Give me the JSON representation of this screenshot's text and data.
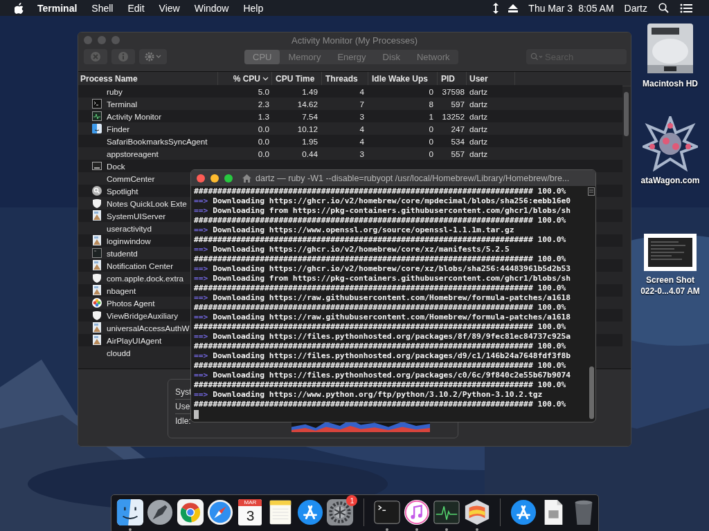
{
  "menu_bar": {
    "app": "Terminal",
    "menus": [
      "Shell",
      "Edit",
      "View",
      "Window",
      "Help"
    ],
    "clock_day": "Thu Mar 3",
    "clock_time": "8:05 AM",
    "user": "Dartz"
  },
  "activity_monitor": {
    "title": "Activity Monitor (My Processes)",
    "tabs": [
      {
        "label": "CPU",
        "selected": true
      },
      {
        "label": "Memory",
        "selected": false
      },
      {
        "label": "Energy",
        "selected": false
      },
      {
        "label": "Disk",
        "selected": false
      },
      {
        "label": "Network",
        "selected": false
      }
    ],
    "search": {
      "placeholder": "Search"
    },
    "columns": [
      {
        "label": "Process Name",
        "sorted": false
      },
      {
        "label": "% CPU",
        "sorted": true
      },
      {
        "label": "CPU Time",
        "sorted": false
      },
      {
        "label": "Threads",
        "sorted": false
      },
      {
        "label": "Idle Wake Ups",
        "sorted": false
      },
      {
        "label": "PID",
        "sorted": false
      },
      {
        "label": "User",
        "sorted": false
      }
    ],
    "processes": [
      {
        "name": "ruby",
        "kind": "plain",
        "values": [
          "5.0",
          "1.49",
          "4",
          "0",
          "37598",
          "dartz"
        ]
      },
      {
        "name": "Terminal",
        "kind": "terminal",
        "values": [
          "2.3",
          "14.62",
          "7",
          "8",
          "597",
          "dartz"
        ]
      },
      {
        "name": "Activity Monitor",
        "kind": "monitor",
        "values": [
          "1.3",
          "7.54",
          "3",
          "1",
          "13252",
          "dartz"
        ]
      },
      {
        "name": "Finder",
        "kind": "finder",
        "values": [
          "0.0",
          "10.12",
          "4",
          "0",
          "247",
          "dartz"
        ]
      },
      {
        "name": "SafariBookmarksSyncAgent",
        "kind": "plain",
        "values": [
          "0.0",
          "1.95",
          "4",
          "0",
          "534",
          "dartz"
        ]
      },
      {
        "name": "appstoreagent",
        "kind": "plain",
        "values": [
          "0.0",
          "0.44",
          "3",
          "0",
          "557",
          "dartz"
        ]
      },
      {
        "name": "Dock",
        "kind": "dock"
      },
      {
        "name": "CommCenter",
        "kind": "plain"
      },
      {
        "name": "Spotlight",
        "kind": "spotlight"
      },
      {
        "name": "Notes QuickLook Exte",
        "kind": "shield"
      },
      {
        "name": "SystemUIServer",
        "kind": "app"
      },
      {
        "name": "useractivityd",
        "kind": "plain"
      },
      {
        "name": "loginwindow",
        "kind": "app"
      },
      {
        "name": "studentd",
        "kind": "console"
      },
      {
        "name": "Notification Center",
        "kind": "app"
      },
      {
        "name": "com.apple.dock.extra",
        "kind": "shield"
      },
      {
        "name": "nbagent",
        "kind": "app"
      },
      {
        "name": "Photos Agent",
        "kind": "photos"
      },
      {
        "name": "ViewBridgeAuxiliary",
        "kind": "shield"
      },
      {
        "name": "universalAccessAuthW",
        "kind": "app"
      },
      {
        "name": "AirPlayUIAgent",
        "kind": "app"
      },
      {
        "name": "cloudd",
        "kind": "plain"
      }
    ],
    "summary_labels": [
      "Syst",
      "Use",
      "Idle:"
    ]
  },
  "terminal": {
    "title": "dartz — ruby -W1 --disable=rubyopt /usr/local/Homebrew/Library/Homebrew/bre...",
    "lines": [
      {
        "kind": "progress",
        "bar": "########################################################################",
        "percent": "100.0%"
      },
      {
        "kind": "download",
        "prompt": "==>",
        "text": "Downloading https://ghcr.io/v2/homebrew/core/mpdecimal/blobs/sha256:eebb16e0"
      },
      {
        "kind": "download",
        "prompt": "==>",
        "text": "Downloading from https://pkg-containers.githubusercontent.com/ghcr1/blobs/sh"
      },
      {
        "kind": "progress",
        "bar": "########################################################################",
        "percent": "100.0%"
      },
      {
        "kind": "download",
        "prompt": "==>",
        "text": "Downloading https://www.openssl.org/source/openssl-1.1.1m.tar.gz"
      },
      {
        "kind": "progress",
        "bar": "########################################################################",
        "percent": "100.0%"
      },
      {
        "kind": "download",
        "prompt": "==>",
        "text": "Downloading https://ghcr.io/v2/homebrew/core/xz/manifests/5.2.5"
      },
      {
        "kind": "progress",
        "bar": "########################################################################",
        "percent": "100.0%"
      },
      {
        "kind": "download",
        "prompt": "==>",
        "text": "Downloading https://ghcr.io/v2/homebrew/core/xz/blobs/sha256:44483961b5d2b53"
      },
      {
        "kind": "download",
        "prompt": "==>",
        "text": "Downloading from https://pkg-containers.githubusercontent.com/ghcr1/blobs/sh"
      },
      {
        "kind": "progress",
        "bar": "########################################################################",
        "percent": "100.0%"
      },
      {
        "kind": "download",
        "prompt": "==>",
        "text": "Downloading https://raw.githubusercontent.com/Homebrew/formula-patches/a1618"
      },
      {
        "kind": "progress",
        "bar": "########################################################################",
        "percent": "100.0%"
      },
      {
        "kind": "download",
        "prompt": "==>",
        "text": "Downloading https://raw.githubusercontent.com/Homebrew/formula-patches/a1618"
      },
      {
        "kind": "progress",
        "bar": "########################################################################",
        "percent": "100.0%"
      },
      {
        "kind": "download",
        "prompt": "==>",
        "text": "Downloading https://files.pythonhosted.org/packages/8f/89/9fec81ec84737c925a"
      },
      {
        "kind": "progress",
        "bar": "########################################################################",
        "percent": "100.0%"
      },
      {
        "kind": "download",
        "prompt": "==>",
        "text": "Downloading https://files.pythonhosted.org/packages/d9/c1/146b24a7648fdf3f8b"
      },
      {
        "kind": "progress",
        "bar": "########################################################################",
        "percent": "100.0%"
      },
      {
        "kind": "download",
        "prompt": "==>",
        "text": "Downloading https://files.pythonhosted.org/packages/c0/6c/9f840c2e55b67b9074"
      },
      {
        "kind": "progress",
        "bar": "########################################################################",
        "percent": "100.0%"
      },
      {
        "kind": "download",
        "prompt": "==>",
        "text": "Downloading https://www.python.org/ftp/python/3.10.2/Python-3.10.2.tgz"
      },
      {
        "kind": "progress",
        "bar": "########################################################################",
        "percent": "100.0%"
      },
      {
        "kind": "cursor"
      }
    ]
  },
  "desktop_icons": [
    {
      "kind": "drive",
      "label": "Macintosh HD"
    },
    {
      "kind": "star",
      "label": "ataWagon.com"
    },
    {
      "kind": "screenshot",
      "label": "Screen Shot",
      "label_2": "022-0...4.07 AM"
    }
  ],
  "dock": [
    {
      "kind": "finder",
      "running": true
    },
    {
      "kind": "launchpad",
      "running": false
    },
    {
      "kind": "browser",
      "running": false
    },
    {
      "kind": "compass",
      "running": false
    },
    {
      "kind": "calendar",
      "month": "MAR",
      "day": "3",
      "running": false
    },
    {
      "kind": "notes",
      "running": false
    },
    {
      "kind": "store",
      "running": false
    },
    {
      "kind": "settings",
      "badge": "1",
      "running": false
    },
    {
      "kind": "separator"
    },
    {
      "kind": "terminal",
      "running": true
    },
    {
      "kind": "music",
      "running": true
    },
    {
      "kind": "monitor",
      "running": true
    },
    {
      "kind": "grapher",
      "running": true
    },
    {
      "kind": "separator"
    },
    {
      "kind": "store",
      "running": false
    },
    {
      "kind": "document",
      "running": false
    },
    {
      "kind": "trash",
      "running": false
    }
  ]
}
